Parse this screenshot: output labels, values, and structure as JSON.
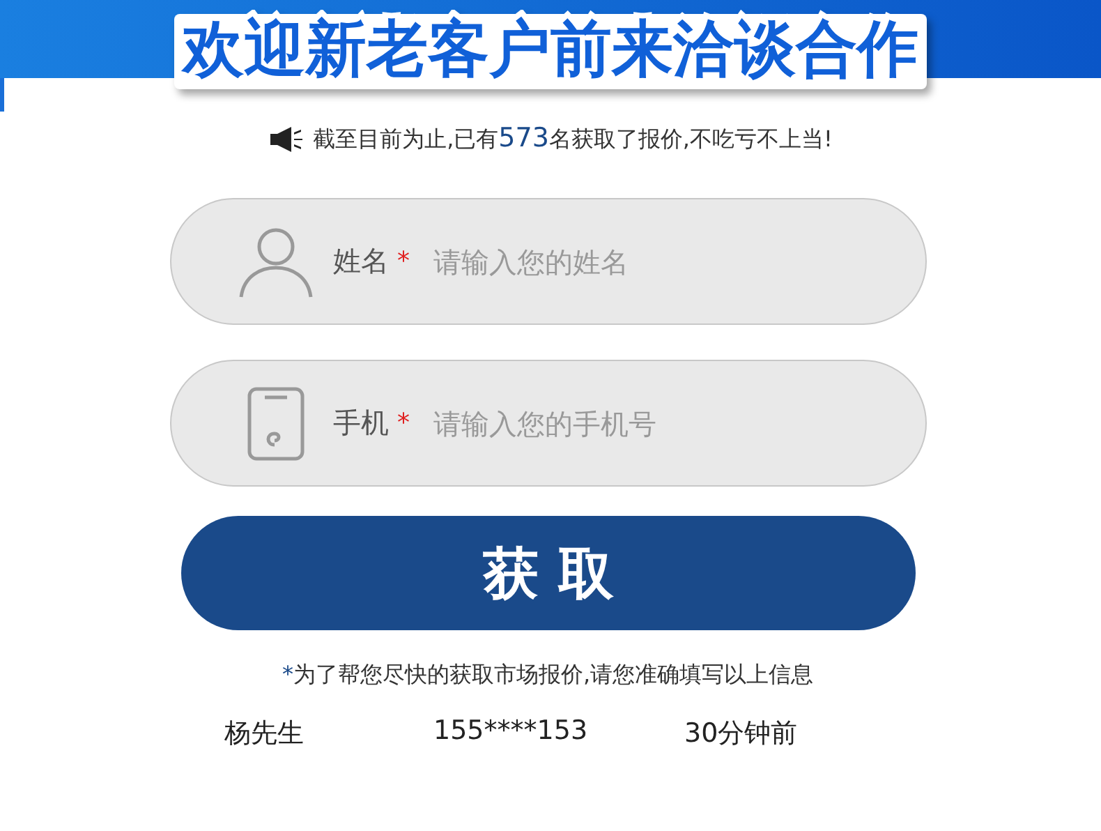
{
  "banner": {
    "title": "欢迎新老客户前来洽谈合作"
  },
  "notice": {
    "before": "截至目前为止,已有",
    "count": "573",
    "after": "名获取了报价,不吃亏不上当!"
  },
  "fields": [
    {
      "kind": "person",
      "label": "姓名",
      "required_mark": "*",
      "placeholder": "请输入您的姓名"
    },
    {
      "kind": "phone",
      "label": "手机",
      "required_mark": "*",
      "placeholder": "请输入您的手机号"
    }
  ],
  "submit_button": "获 取",
  "note": {
    "mark": "*",
    "text": "为了帮您尽快的获取市场报价,请您准确填写以上信息"
  },
  "recent": [
    {
      "name": "杨先生",
      "phone": "155****153",
      "time": "30分钟前"
    }
  ]
}
